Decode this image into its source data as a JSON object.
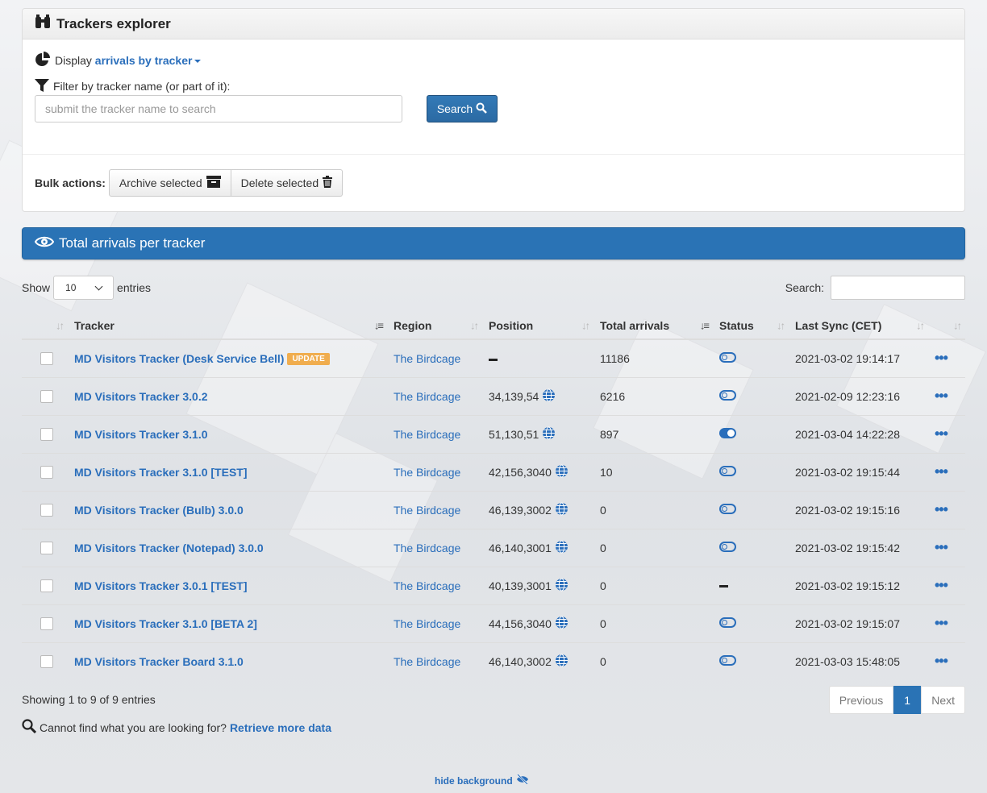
{
  "header": {
    "title": "Trackers explorer"
  },
  "display": {
    "prefix": "Display",
    "mode": "arrivals by tracker"
  },
  "filter": {
    "label": "Filter by tracker name (or part of it):",
    "placeholder": "submit the tracker name to search",
    "value": "",
    "search_label": "Search"
  },
  "bulk": {
    "label": "Bulk actions:",
    "archive_label": "Archive selected",
    "delete_label": "Delete selected"
  },
  "table_panel": {
    "title": "Total arrivals per tracker"
  },
  "controls": {
    "show_prefix": "Show",
    "show_value": "10",
    "show_suffix": "entries",
    "search_label": "Search:"
  },
  "columns": [
    "Tracker",
    "Region",
    "Position",
    "Total arrivals",
    "Status",
    "Last Sync (CET)"
  ],
  "rows": [
    {
      "tracker": "MD Visitors Tracker (Desk Service Bell)",
      "badge": "UPDATE",
      "region": "The Birdcage",
      "position": "",
      "arrivals": "11186",
      "status": "off",
      "sync": "2021-03-02 19:14:17"
    },
    {
      "tracker": "MD Visitors Tracker 3.0.2",
      "badge": "",
      "region": "The Birdcage",
      "position": "34,139,54",
      "arrivals": "6216",
      "status": "off",
      "sync": "2021-02-09 12:23:16"
    },
    {
      "tracker": "MD Visitors Tracker 3.1.0",
      "badge": "",
      "region": "The Birdcage",
      "position": "51,130,51",
      "arrivals": "897",
      "status": "on",
      "sync": "2021-03-04 14:22:28"
    },
    {
      "tracker": "MD Visitors Tracker 3.1.0 [TEST]",
      "badge": "",
      "region": "The Birdcage",
      "position": "42,156,3040",
      "arrivals": "10",
      "status": "off",
      "sync": "2021-03-02 19:15:44"
    },
    {
      "tracker": "MD Visitors Tracker (Bulb) 3.0.0",
      "badge": "",
      "region": "The Birdcage",
      "position": "46,139,3002",
      "arrivals": "0",
      "status": "off",
      "sync": "2021-03-02 19:15:16"
    },
    {
      "tracker": "MD Visitors Tracker (Notepad) 3.0.0",
      "badge": "",
      "region": "The Birdcage",
      "position": "46,140,3001",
      "arrivals": "0",
      "status": "off",
      "sync": "2021-03-02 19:15:42"
    },
    {
      "tracker": "MD Visitors Tracker 3.0.1 [TEST]",
      "badge": "",
      "region": "The Birdcage",
      "position": "40,139,3001",
      "arrivals": "0",
      "status": "none",
      "sync": "2021-03-02 19:15:12"
    },
    {
      "tracker": "MD Visitors Tracker 3.1.0 [BETA 2]",
      "badge": "",
      "region": "The Birdcage",
      "position": "44,156,3040",
      "arrivals": "0",
      "status": "off",
      "sync": "2021-03-02 19:15:07"
    },
    {
      "tracker": "MD Visitors Tracker Board 3.1.0",
      "badge": "",
      "region": "The Birdcage",
      "position": "46,140,3002",
      "arrivals": "0",
      "status": "off",
      "sync": "2021-03-03 15:48:05"
    }
  ],
  "footer": {
    "info": "Showing 1 to 9 of 9 entries",
    "prev": "Previous",
    "page": "1",
    "next": "Next",
    "cannot_find": "Cannot find what you are looking for?",
    "retrieve": "Retrieve more data",
    "hide_bg": "hide background"
  },
  "colors": {
    "accent": "#2a73b5",
    "link": "#2a6ebb",
    "badge": "#f0ad4e"
  }
}
